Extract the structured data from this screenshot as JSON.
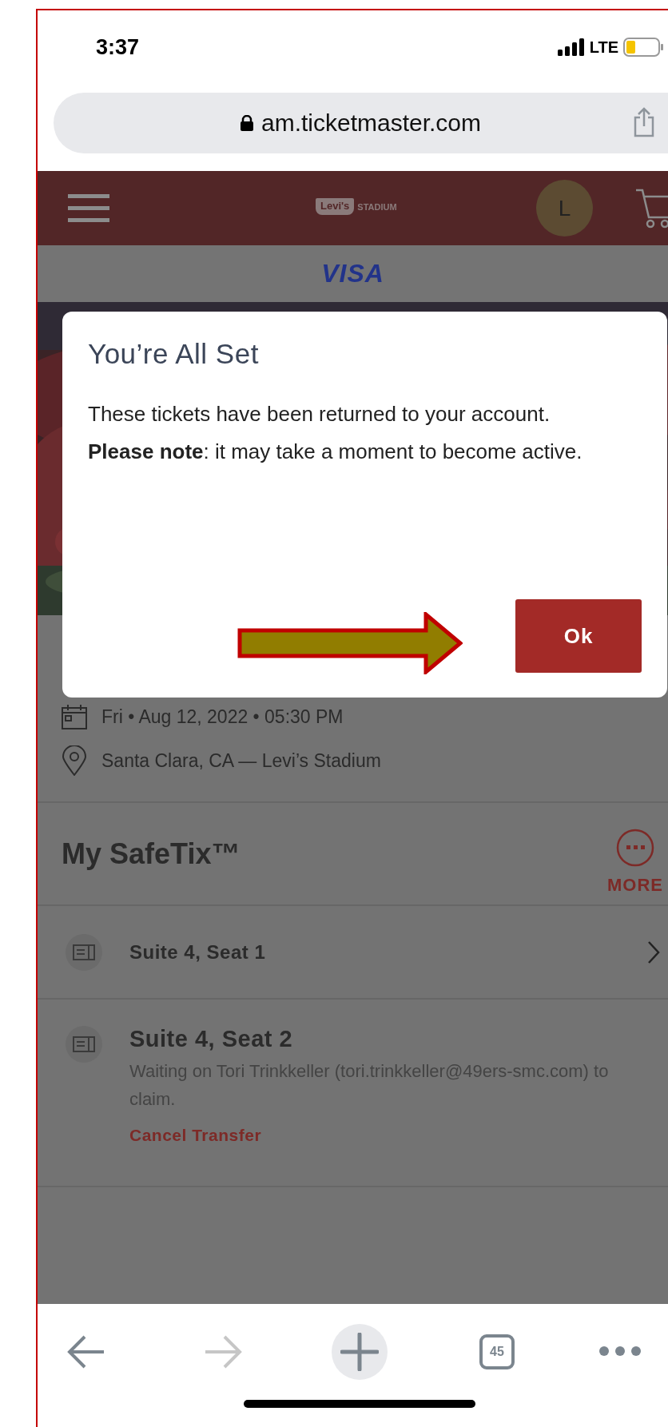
{
  "status_bar": {
    "time": "3:37",
    "network": "LTE"
  },
  "address_bar": {
    "url": "am.ticketmaster.com"
  },
  "site_header": {
    "logo_brand": "Levi's",
    "logo_text": "STADIUM",
    "avatar_letter": "L"
  },
  "sponsor": {
    "name": "VISA"
  },
  "dialog": {
    "title": "You’re All Set",
    "message": "These tickets have been returned to your account.",
    "note": "**Please note**: it may take a moment to become active.",
    "button": "Ok"
  },
  "event": {
    "date": "Fri • Aug 12, 2022 • 05:30 PM",
    "venue": "Santa Clara, CA — Levi’s Stadium"
  },
  "safetix": {
    "title": "My SafeTix™",
    "more": "MORE",
    "tickets": [
      {
        "kind": "link",
        "label": "Suite 4, Seat 1"
      },
      {
        "kind": "pending",
        "label": "Suite 4, Seat 2",
        "status": "Waiting on Tori Trinkkeller (tori.trinkkeller@49ers-smc.com) to claim.",
        "action": "Cancel Transfer"
      }
    ]
  },
  "browser_toolbar": {
    "forward_disabled": true,
    "tab_count": "45"
  }
}
